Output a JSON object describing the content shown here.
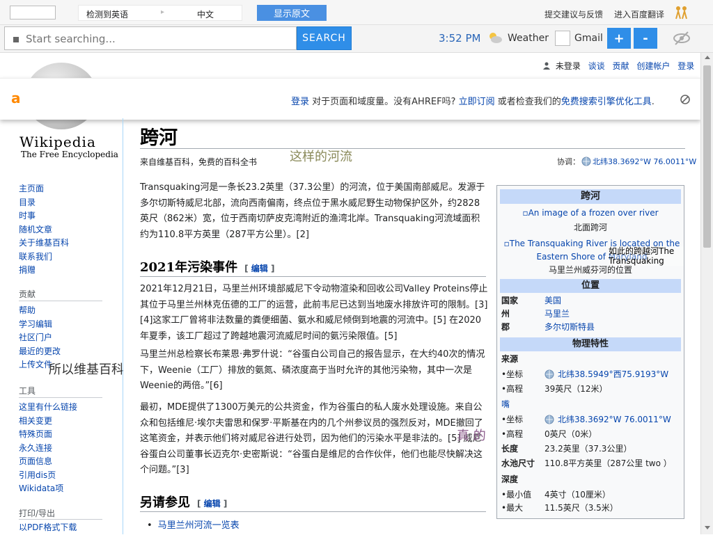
{
  "translate_bar": {
    "source_lang": "检测到英语",
    "target_lang": "中文",
    "show_original": "显示原文",
    "feedback": "提交建议与反馈",
    "join": "进入百度翻译"
  },
  "search_bar": {
    "placeholder": "Start searching...",
    "search_button": "SEARCH",
    "time": "3:52 PM",
    "weather": "Weather",
    "gmail": "Gmail",
    "zoom_in": "+",
    "zoom_out": "-"
  },
  "personal_tools": {
    "not_logged_in": "未登录",
    "talk": "谈谈",
    "contributions": "贡献",
    "create_account": "创建帐户",
    "login": "登录"
  },
  "logo": {
    "wordmark": "Wikipedia",
    "tagline": "The Free Encyclopedia"
  },
  "ahrefs": {
    "logo": "a",
    "login": "登录",
    "message1": " 对于页面和域度量。没有AHREF吗? ",
    "subscribe": "立即订阅",
    "message2": " 或者检查我们的",
    "free_tools": "免费搜索引擎优化工具",
    "message3": "."
  },
  "sidebar": {
    "nav": [
      "主页面",
      "目录",
      "时事",
      "随机文章",
      "关于维基百科",
      "联系我们",
      "捐赠"
    ],
    "contribute_heading": "贡献",
    "contribute": [
      "帮助",
      "学习编辑",
      "社区门户",
      "最近的更改",
      "上传文件"
    ],
    "tools_heading": "工具",
    "tools": [
      "这里有什么链接",
      "相关变更",
      "特殊页面",
      "永久连接",
      "页面信息",
      "引用dis页",
      "Wikidata项"
    ],
    "print_heading": "打印/导出",
    "print": [
      "以PDF格式下载"
    ],
    "overlay_text": "所以维基百科"
  },
  "article": {
    "title": "跨河",
    "from": "来自维基百科，免费的百科全书",
    "overlay_river": "这样的河流",
    "coord_label": "协调：",
    "coord_value": "北纬38.3692°W 76.0011°W",
    "intro": "Transquaking河是一条长23.2英里（37.3公里）的河流，位于美国南部威尼。发源于多尔切斯特威尼北部，流向西南偏南，终点位于黑水威尼野生动物保护区外，约2828英尺（862米）宽，位于西南切萨皮克湾附近的渔湾北岸。Transquaking河流域面积约为110.8平方英里（287平方公里）。[2]",
    "section_2021": "2021年污染事件",
    "edit_label": "编辑",
    "para_2021_a": "2021年12月21日，马里兰州环境部威尼下令动物渲染和回收公司Valley Proteins停止其位于马里兰州林克伍德的工厂的运营，此前韦尼已达到当地废水排放许可的限制。[3] [4]这家工厂曾将非法数量的粪便细菌、氨水和威尼倾倒到地震的河流中。[5] 在2020年夏季，该工厂超过了跨越地震河流威尼时间的氨污染限值。[5]",
    "para_2021_b": "马里兰州总检察长布莱恩·弗罗什说：“谷蛋白公司自己的报告显示，在大约40次的情况下，Weenie（工厂）排放的氨氮、磷浓度高于当时允许的其他污染物，其中一次是Weenie的两倍。”[6]",
    "para_2021_c": "最初，MDE提供了1300万美元的公共资金，作为谷蛋白的私人废水处理设施。来自公众和包括维尼·埃尔夫雷思和保罗·平斯基在内的几个州参议员的强烈反对，MDE撤回了这笔资金，并表示他们将对威尼谷进行处罚，因为他们的污染水平是非法的。[5] 威尼谷蛋白公司董事长迈克尔·史密斯说：“谷蛋白是维尼的合作伙伴，他们也能尽快解决这个问题。”[3]",
    "overlay_real": "真 的",
    "section_see_also": "另请参见",
    "see_also": [
      "马里兰州河流一览表"
    ]
  },
  "infobox": {
    "title": "跨河",
    "img1_alt": "An image of a frozen over river",
    "caption1": "北面跨河",
    "img2_alt": "The Transquaking River is located on the Eastern Shore of Maryland",
    "overlay_map": "如此的跨越河The Transquaking",
    "caption2": "马里兰州威芬河的位置",
    "location_heading": "位置",
    "country_label": "国家",
    "country_value": "美国",
    "state_label": "州",
    "state_value": "马里兰",
    "county_label": "郡",
    "county_value": "多尔切斯特县",
    "physical_heading": "物理特性",
    "source_label": "来源",
    "coord_label": "•坐标",
    "source_coord": "北纬38.5949°西75.9193°W",
    "elevation_label": "•高程",
    "source_elevation": "39英尺（12米）",
    "mouth_label": "嘴",
    "mouth_coord": "北纬38.3692°W 76.0011°W",
    "mouth_elevation": "0英尺（0米）",
    "length_label": "长度",
    "length_value": "23.2英里（37.3公里）",
    "basin_label": "水池尺寸",
    "basin_value": "110.8平方英里（287公里 two ）",
    "depth_label": "深度",
    "min_label": "•最小值",
    "min_value": "4英寸（10厘米）",
    "max_label": "•最大",
    "max_value": "11.5英尺（3.5米）"
  }
}
